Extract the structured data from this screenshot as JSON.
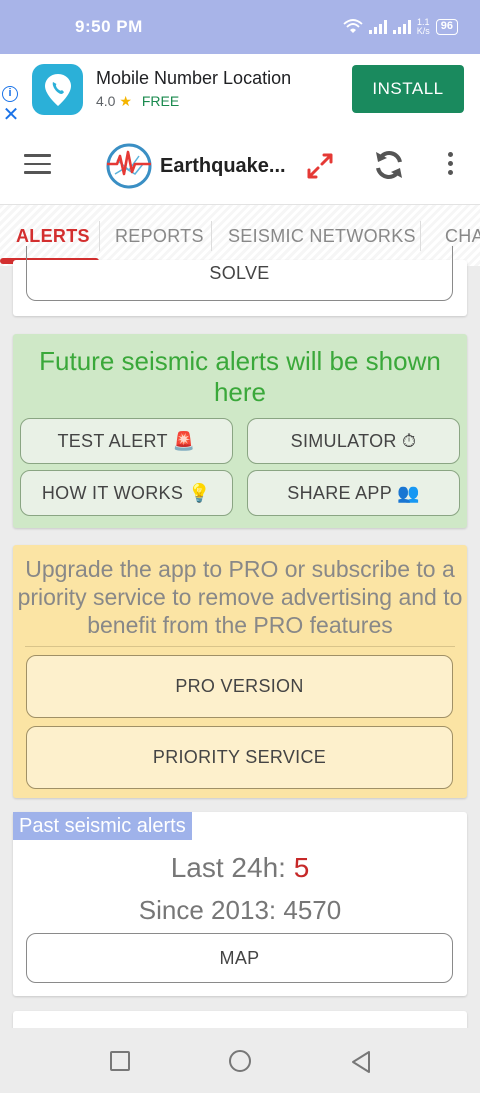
{
  "status_bar": {
    "time": "9:50 PM",
    "speed_value": "1.1",
    "speed_unit": "K/s",
    "battery": "96"
  },
  "ad": {
    "title": "Mobile Number Location",
    "rating": "4.0",
    "price": "FREE",
    "install_label": "INSTALL",
    "info_glyph": "i",
    "close_glyph": "✕"
  },
  "toolbar": {
    "app_title": "Earthquake..."
  },
  "tabs": [
    "ALERTS",
    "REPORTS",
    "SEISMIC NETWORKS",
    "CHA"
  ],
  "top_card": {
    "solve_label": "SOLVE"
  },
  "alerts_card": {
    "title": "Future seismic alerts will be shown here",
    "test_alert_label": "TEST ALERT 🚨",
    "simulator_label": "SIMULATOR ⏱",
    "how_it_works_label": "HOW IT WORKS 💡",
    "share_app_label": "SHARE APP 👥"
  },
  "upgrade_card": {
    "text": "Upgrade the app to PRO or subscribe to a priority service to remove advertising and to benefit from the PRO features",
    "pro_version_label": "PRO VERSION",
    "priority_service_label": "PRIORITY SERVICE"
  },
  "past_card": {
    "heading": "Past seismic alerts",
    "last24_label": "Last 24h: ",
    "last24_value": "5",
    "since_label": "Since 2013: ",
    "since_value": "4570",
    "map_label": "MAP"
  },
  "colors": {
    "status_bar": "#a8b4e8",
    "install_green": "#1a8a5e",
    "accent_red": "#d32f2f",
    "alert_green_bg": "#cfe8c7",
    "alert_green_text": "#3aa83a",
    "upgrade_yellow_bg": "#fbe4a4",
    "highlight_blue": "#9fb2ea"
  },
  "icons": {
    "menu": "hamburger-icon",
    "logo": "seismograph-globe-icon",
    "expand": "expand-arrows-icon",
    "refresh": "refresh-icon",
    "more": "more-vertical-icon",
    "ad_app": "phone-location-icon"
  }
}
